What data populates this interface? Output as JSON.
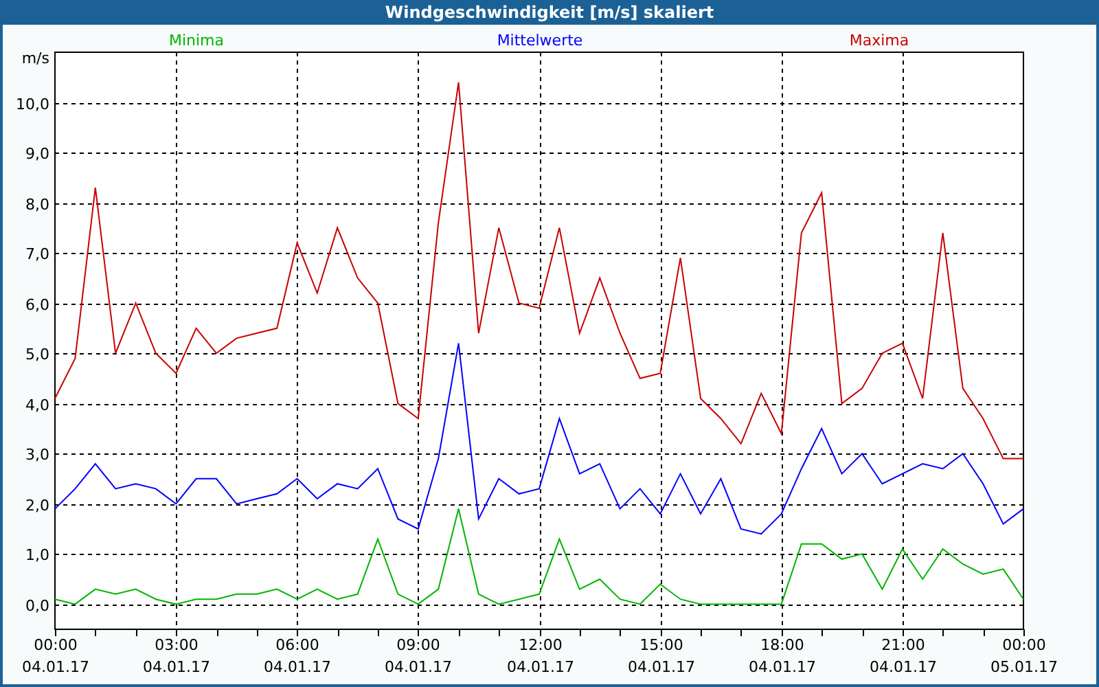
{
  "window": {
    "title": "Windgeschwindigkeit [m/s] skaliert"
  },
  "chart_data": {
    "type": "line",
    "ylabel": "m/s",
    "categories": [
      "00:00\n04.01.17",
      null,
      null,
      null,
      null,
      null,
      "03:00\n04.01.17",
      null,
      null,
      null,
      null,
      null,
      "06:00\n04.01.17",
      null,
      null,
      null,
      null,
      null,
      "09:00\n04.01.17",
      null,
      null,
      null,
      null,
      null,
      "12:00\n04.01.17",
      null,
      null,
      null,
      null,
      null,
      "15:00\n04.01.17",
      null,
      null,
      null,
      null,
      null,
      "18:00\n04.01.17",
      null,
      null,
      null,
      null,
      null,
      "21:00\n04.01.17",
      null,
      null,
      null,
      null,
      null,
      "00:00\n05.01.17"
    ],
    "series": [
      {
        "name": "Minima",
        "color": "#00b400",
        "values": [
          0.1,
          0.0,
          0.3,
          0.2,
          0.3,
          0.1,
          0.0,
          0.1,
          0.1,
          0.2,
          0.2,
          0.3,
          0.1,
          0.3,
          0.1,
          0.2,
          1.3,
          0.2,
          0.0,
          0.3,
          1.9,
          0.2,
          0.0,
          0.1,
          0.2,
          1.3,
          0.3,
          0.5,
          0.1,
          0.0,
          0.4,
          0.1,
          0.0,
          0.0,
          0.0,
          0.0,
          0.0,
          1.2,
          1.2,
          0.9,
          1.0,
          0.3,
          1.1,
          0.5,
          1.1,
          0.8,
          0.6,
          0.7,
          0.1
        ]
      },
      {
        "name": "Mittelwerte",
        "color": "#0000ff",
        "values": [
          1.9,
          2.3,
          2.8,
          2.3,
          2.4,
          2.3,
          2.0,
          2.5,
          2.5,
          2.0,
          2.1,
          2.2,
          2.5,
          2.1,
          2.4,
          2.3,
          2.7,
          1.7,
          1.5,
          2.9,
          5.2,
          1.7,
          2.5,
          2.2,
          2.3,
          3.7,
          2.6,
          2.8,
          1.9,
          2.3,
          1.8,
          2.6,
          1.8,
          2.5,
          1.5,
          1.4,
          1.8,
          2.7,
          3.5,
          2.6,
          3.0,
          2.4,
          2.6,
          2.8,
          2.7,
          3.0,
          2.4,
          1.6,
          1.9
        ]
      },
      {
        "name": "Maxima",
        "color": "#c80000",
        "values": [
          4.1,
          4.9,
          8.3,
          5.0,
          6.0,
          5.0,
          4.6,
          5.5,
          5.0,
          5.3,
          5.4,
          5.5,
          7.2,
          6.2,
          7.5,
          6.5,
          6.0,
          4.0,
          3.7,
          7.6,
          10.4,
          5.4,
          7.5,
          6.0,
          5.9,
          7.5,
          5.4,
          6.5,
          5.4,
          4.5,
          4.6,
          6.9,
          4.1,
          3.7,
          3.2,
          4.2,
          3.4,
          7.4,
          8.2,
          4.0,
          4.3,
          5.0,
          5.2,
          4.1,
          7.4,
          4.3,
          3.7,
          2.9,
          2.9
        ]
      }
    ],
    "ylim": [
      -0.5,
      11
    ],
    "grid": true,
    "yticks": [
      {
        "value": 0,
        "label": "0,0"
      },
      {
        "value": 1,
        "label": "1,0"
      },
      {
        "value": 2,
        "label": "2,0"
      },
      {
        "value": 3,
        "label": "3,0"
      },
      {
        "value": 4,
        "label": "4,0"
      },
      {
        "value": 5,
        "label": "5,0"
      },
      {
        "value": 6,
        "label": "6,0"
      },
      {
        "value": 7,
        "label": "7,0"
      },
      {
        "value": 8,
        "label": "8,0"
      },
      {
        "value": 9,
        "label": "9,0"
      },
      {
        "value": 10,
        "label": "10,0"
      }
    ]
  }
}
